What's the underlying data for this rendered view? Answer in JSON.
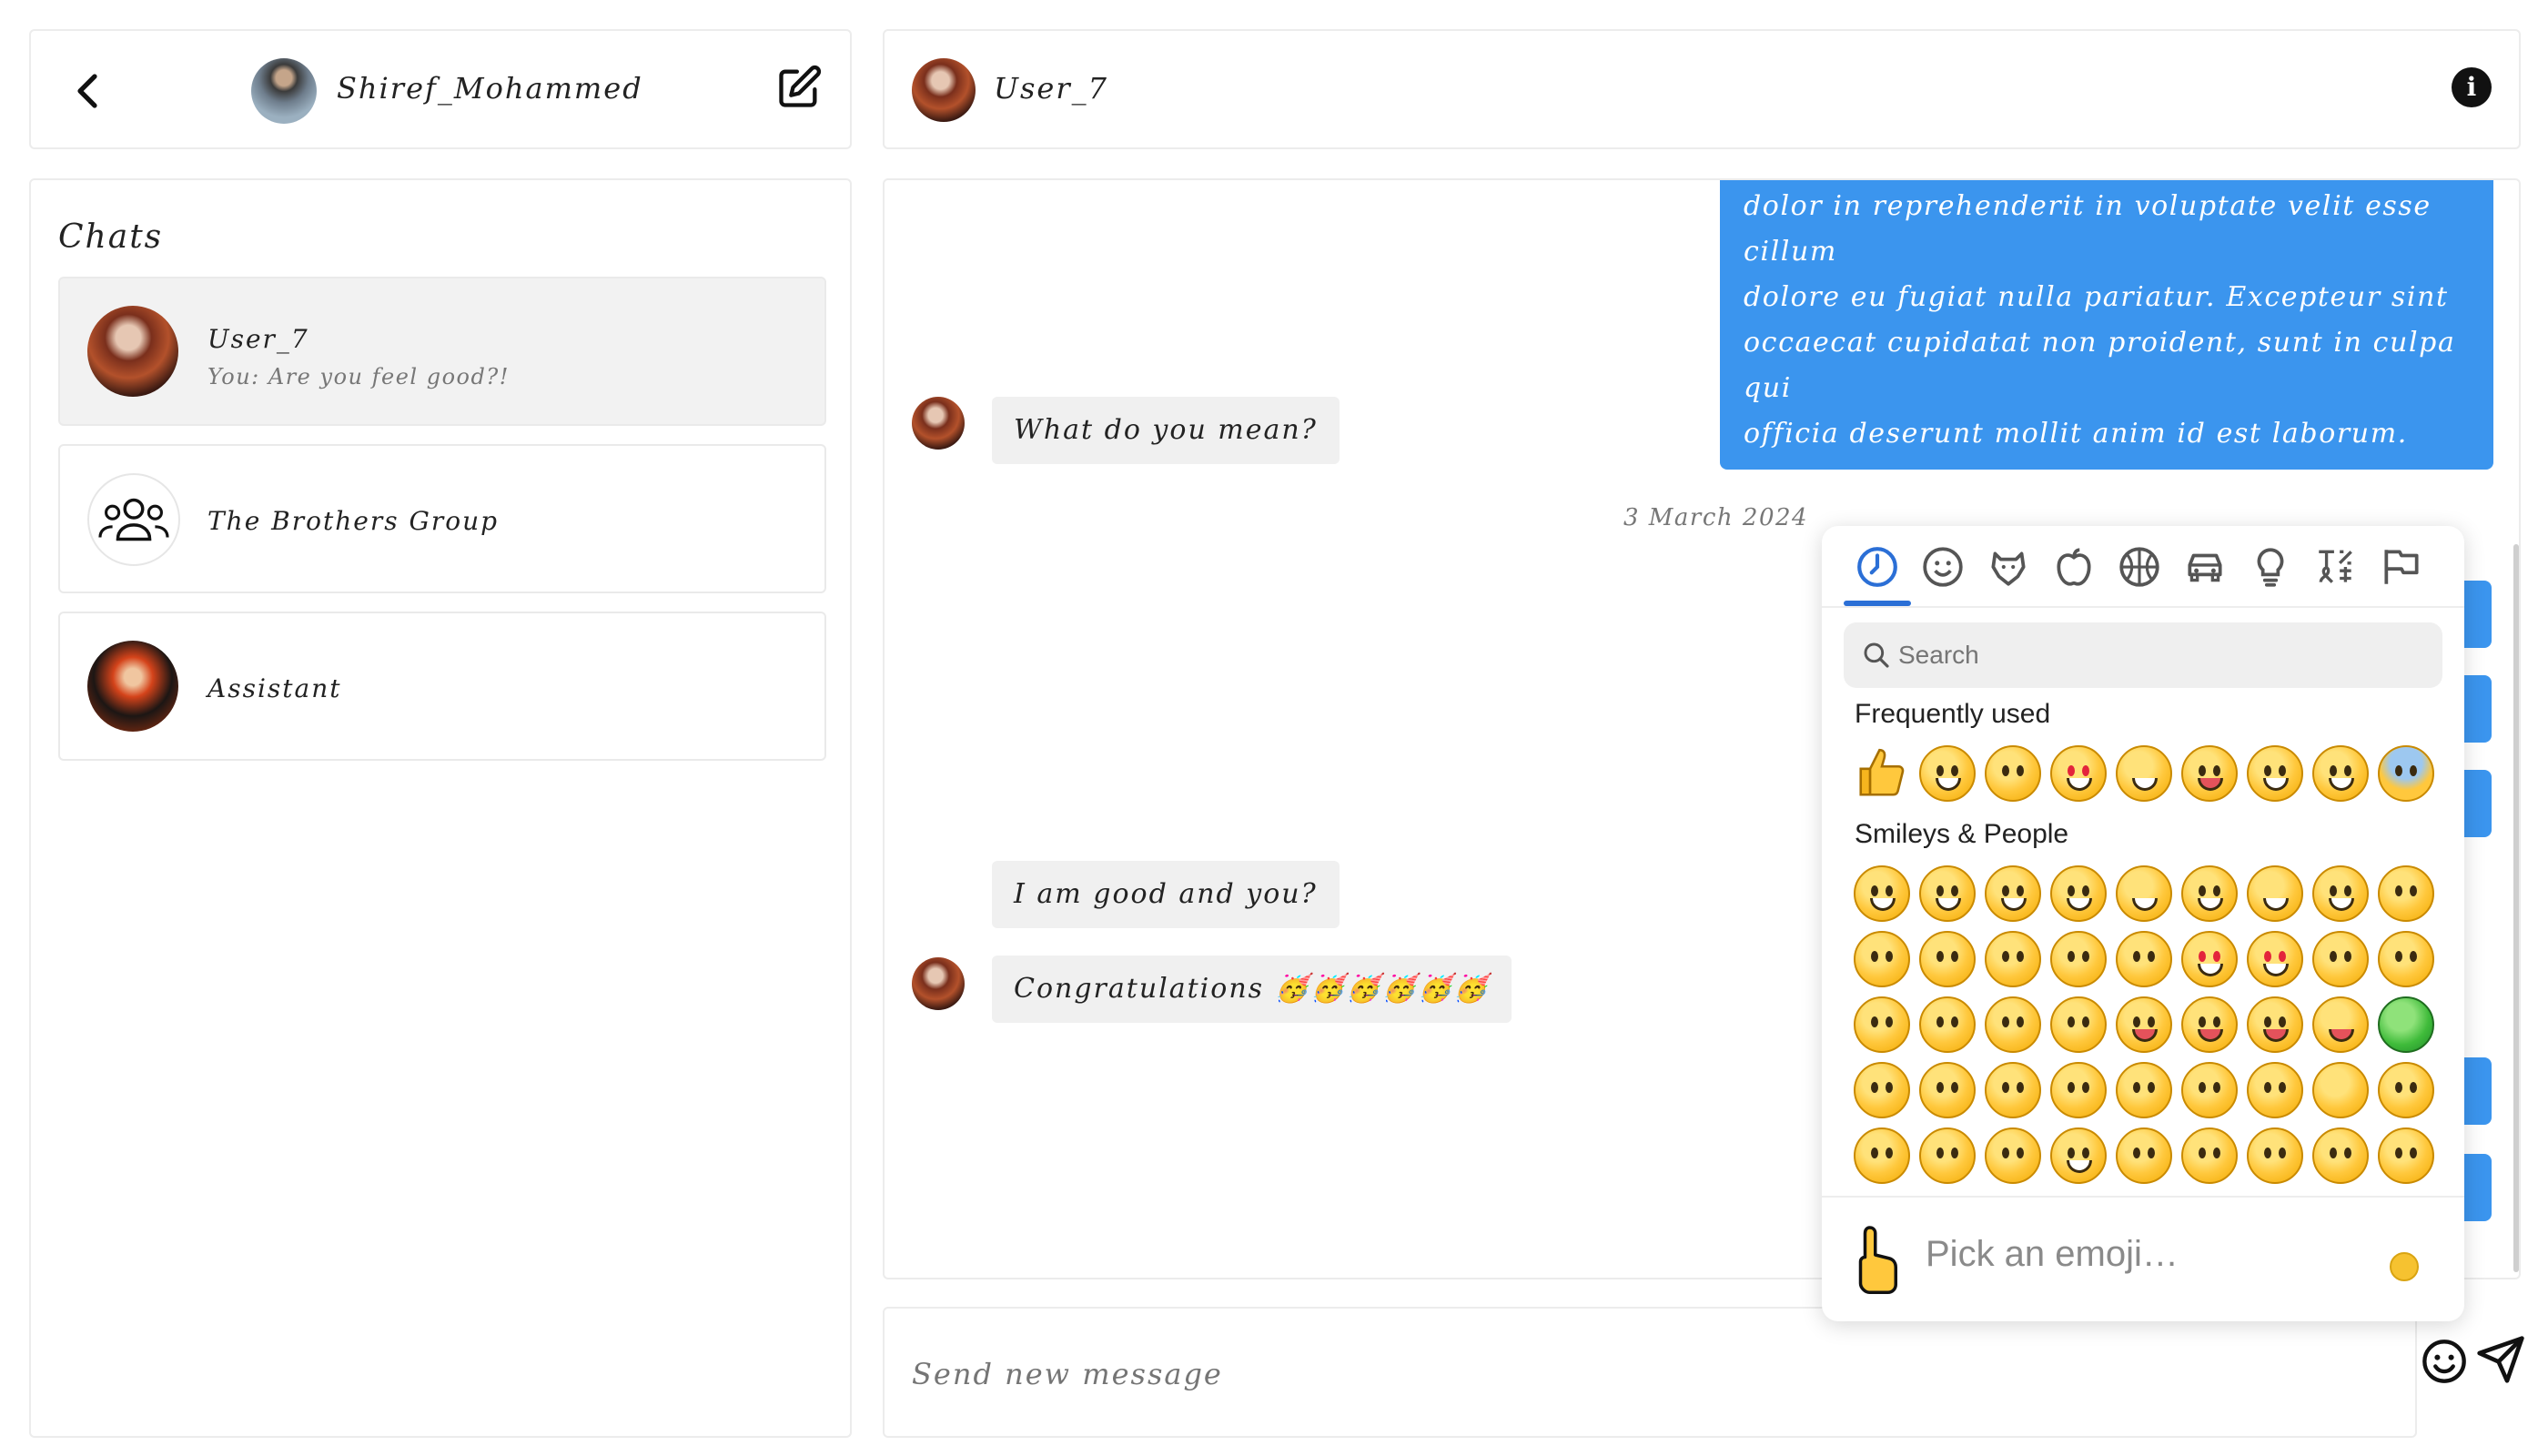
{
  "left_header": {
    "username": "Shiref_Mohammed"
  },
  "right_header": {
    "contact_name": "User_7"
  },
  "chats": {
    "title": "Chats",
    "items": [
      {
        "name": "User_7",
        "last_message": "You: Are you feel good?!"
      },
      {
        "name": "The Brothers Group",
        "last_message": ""
      },
      {
        "name": "Assistant",
        "last_message": ""
      }
    ]
  },
  "messages": {
    "outgoing_long": [
      "dolor in reprehenderit in voluptate velit esse cillum",
      "dolore eu fugiat nulla pariatur. Excepteur sint",
      "occaecat cupidatat non proident, sunt in culpa qui",
      "officia deserunt mollit anim id est laborum."
    ],
    "incoming_1": "What do you mean?",
    "date": "3 March 2024",
    "incoming_2": "I am good and you?",
    "incoming_3": "Congratulations 🥳🥳🥳🥳🥳🥳"
  },
  "composer": {
    "placeholder": "Send new message"
  },
  "emoji_picker": {
    "search_placeholder": "Search",
    "categories": [
      "Frequently used",
      "Smileys & People"
    ],
    "footer_text": "Pick an emoji…",
    "tab_icons": [
      "clock-icon",
      "smiley-icon",
      "animal-icon",
      "food-icon",
      "activity-icon",
      "travel-icon",
      "objects-icon",
      "symbols-icon",
      "flags-icon"
    ]
  },
  "colors": {
    "accent": "#3b95ee",
    "tab_active": "#2b6fd6",
    "bubble_in": "#f0f0f0"
  }
}
